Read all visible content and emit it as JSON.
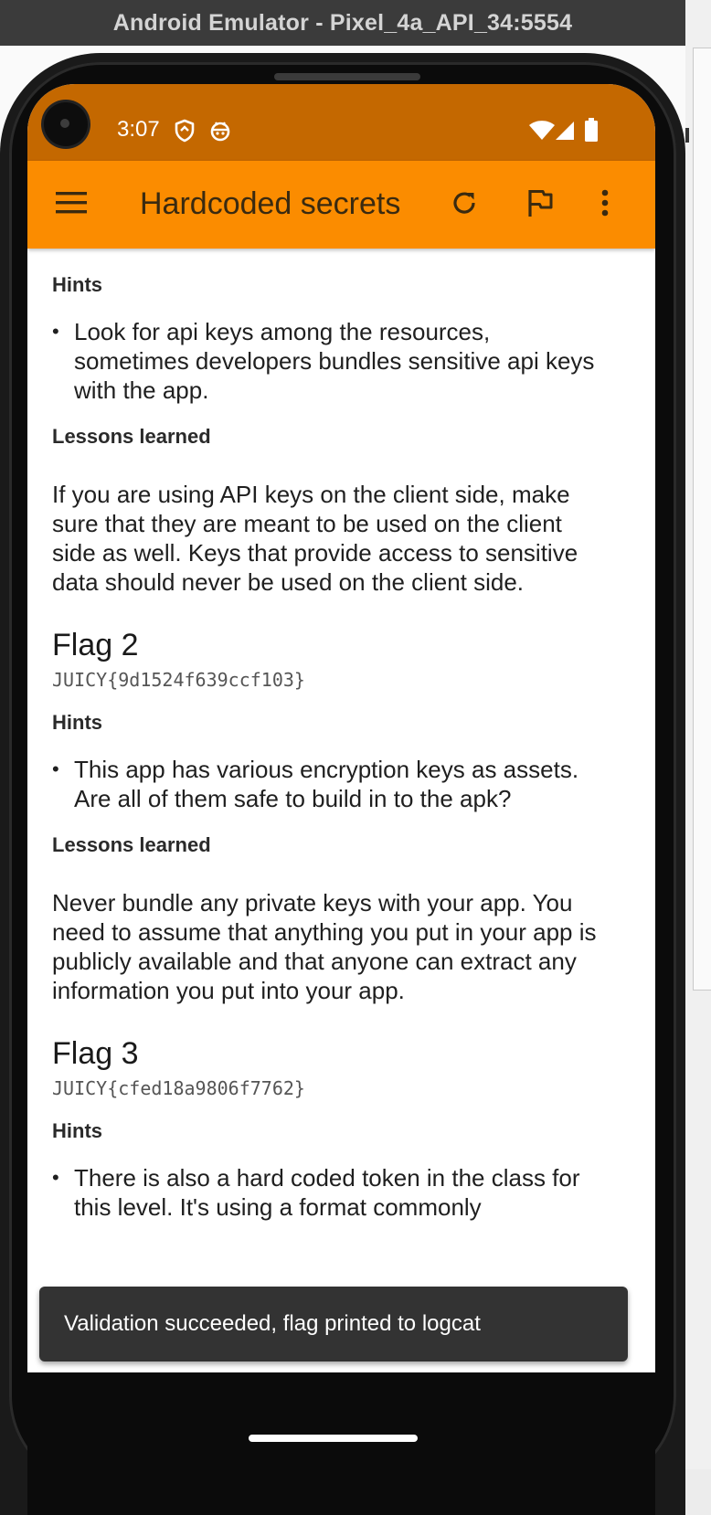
{
  "window": {
    "title": "Android Emulator - Pixel_4a_API_34:5554"
  },
  "status_bar": {
    "time": "3:07",
    "left_icons": [
      "shield-icon",
      "bug-icon"
    ],
    "right_icons": [
      "wifi-icon",
      "signal-icon",
      "battery-icon"
    ]
  },
  "toolbar": {
    "title": "Hardcoded secrets",
    "menu_icon": "menu-icon",
    "actions": [
      "refresh-icon",
      "flag-icon",
      "more-vert-icon"
    ]
  },
  "content": {
    "section1": {
      "hints_heading": "Hints",
      "hint": "Look for api keys among the resources, sometimes developers bundles sensitive api keys with the app.",
      "lessons_heading": "Lessons learned",
      "lesson": "If you are using API keys on the client side, make sure that they are meant to be used on the client side as well. Keys that provide access to sensitive data should never be used on the client side."
    },
    "flag2": {
      "title": "Flag 2",
      "code": "JUICY{9d1524f639ccf103}",
      "hints_heading": "Hints",
      "hint": "This app has various encryption keys as assets. Are all of them safe to build in to the apk?",
      "lessons_heading": "Lessons learned",
      "lesson": "Never bundle any private keys with your app. You need to assume that anything you put in your app is publicly available and that anyone can extract any information you put into your app."
    },
    "flag3": {
      "title": "Flag 3",
      "code": "JUICY{cfed18a9806f7762}",
      "hints_heading": "Hints",
      "hint": "There is also a hard coded token in the class for this level. It's using a format commonly"
    }
  },
  "snackbar": {
    "message": "Validation succeeded, flag printed to logcat"
  },
  "colors": {
    "status_bar": "#c46800",
    "toolbar": "#fb8c00",
    "snackbar": "#333333"
  }
}
